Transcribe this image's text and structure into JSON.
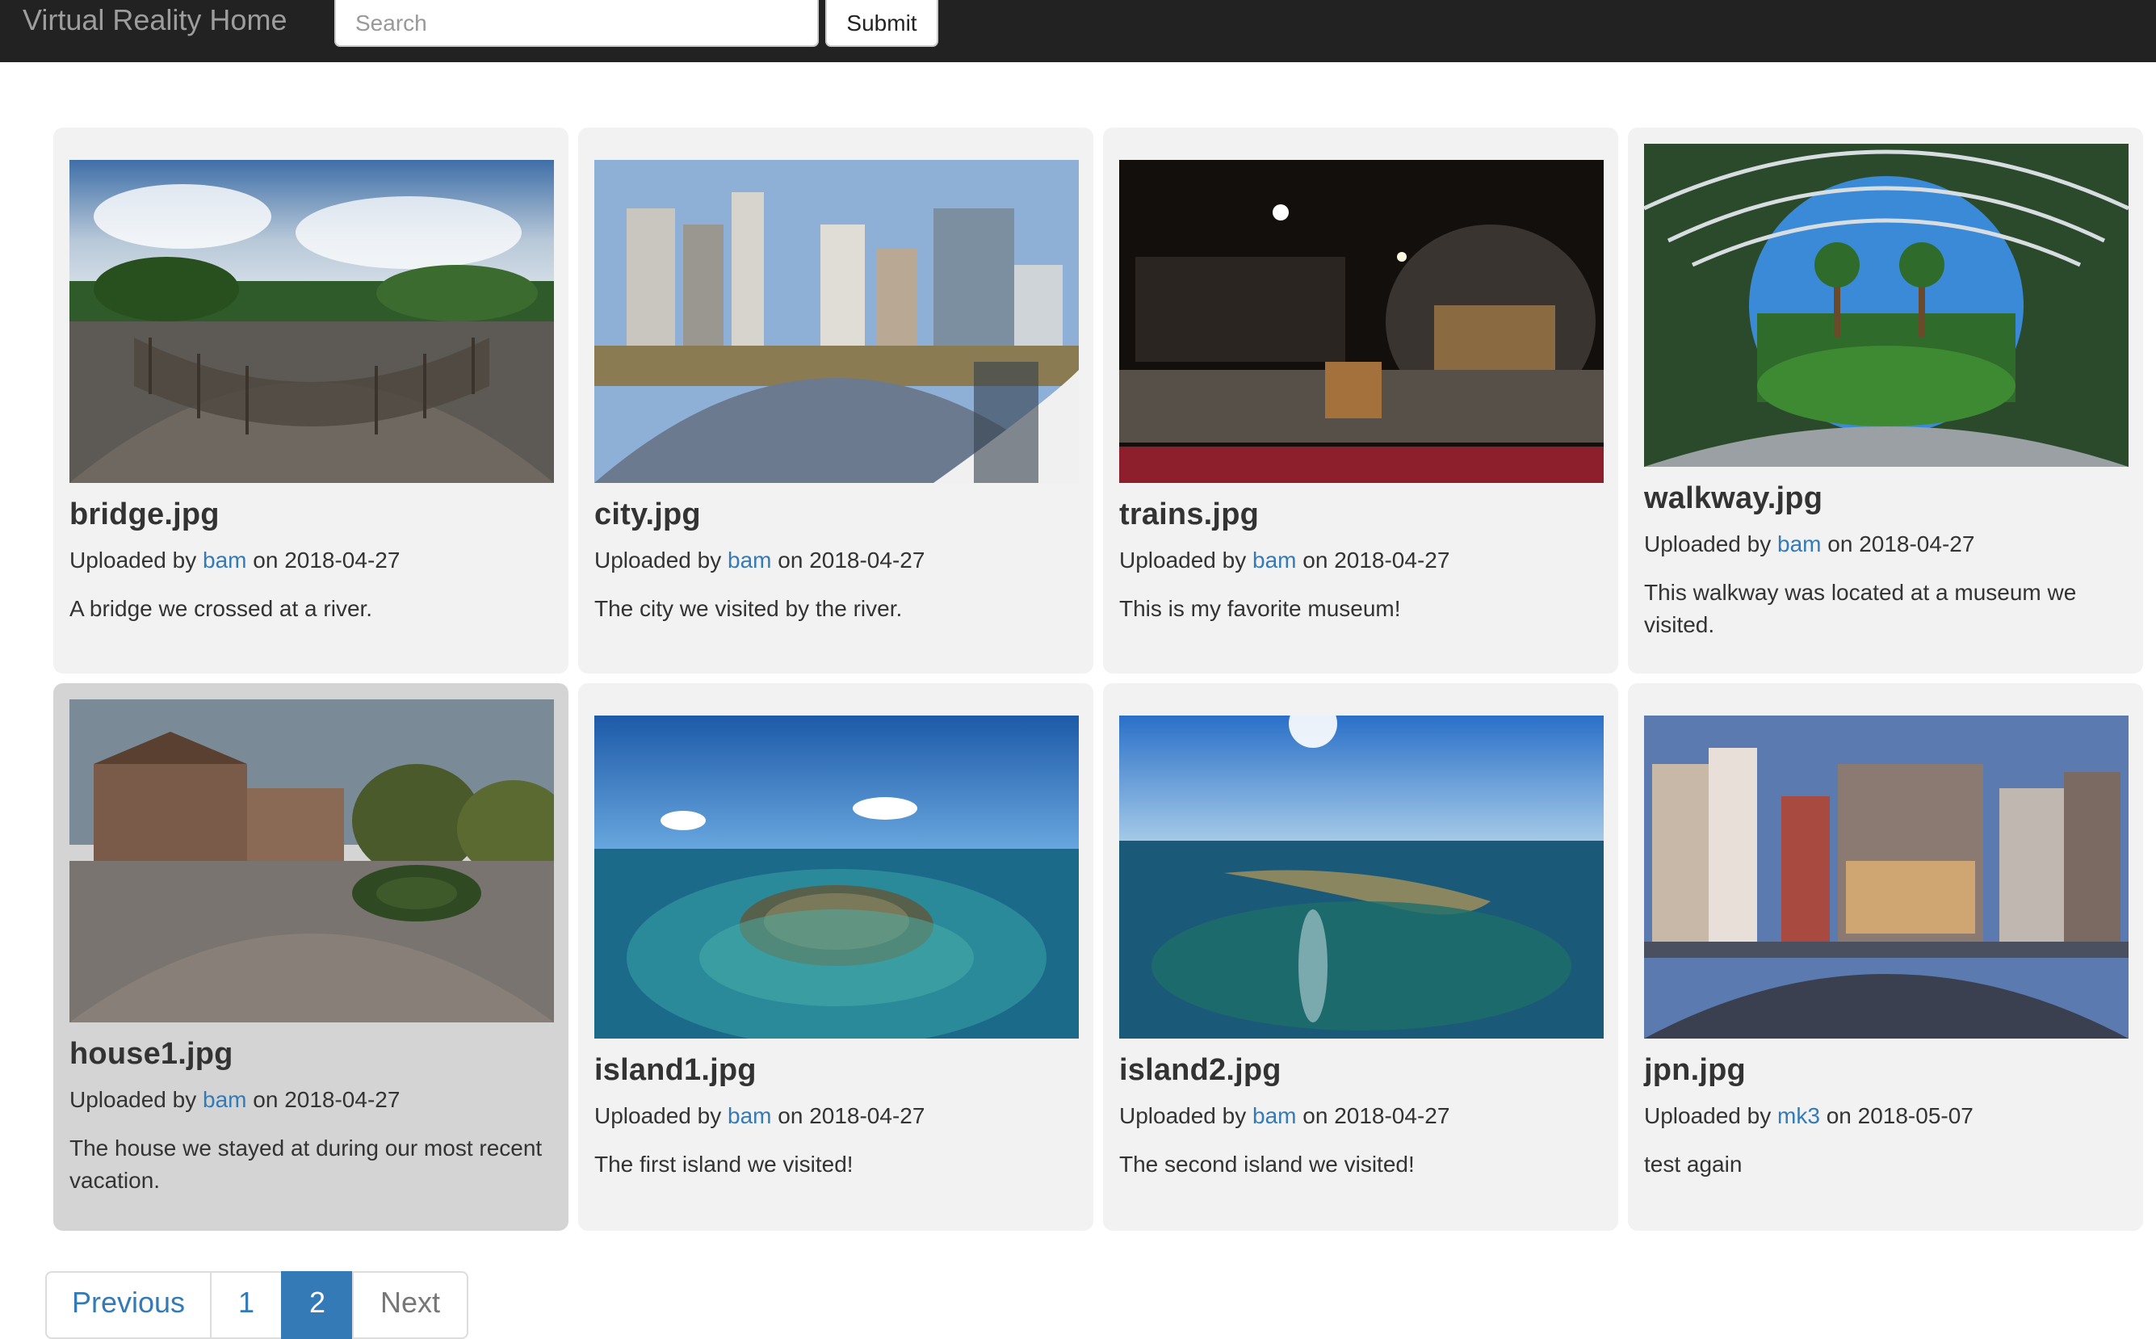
{
  "navbar": {
    "brand": "Virtual Reality Home",
    "search_placeholder": "Search",
    "submit_label": "Submit"
  },
  "cards": [
    {
      "title": "bridge.jpg",
      "uploaded_prefix": "Uploaded by",
      "user": "bam",
      "date_text": "on 2018-04-27",
      "description": "A bridge we crossed at a river."
    },
    {
      "title": "city.jpg",
      "uploaded_prefix": "Uploaded by",
      "user": "bam",
      "date_text": "on 2018-04-27",
      "description": "The city we visited by the river."
    },
    {
      "title": "trains.jpg",
      "uploaded_prefix": "Uploaded by",
      "user": "bam",
      "date_text": "on 2018-04-27",
      "description": "This is my favorite museum!"
    },
    {
      "title": "walkway.jpg",
      "uploaded_prefix": "Uploaded by",
      "user": "bam",
      "date_text": "on 2018-04-27",
      "description": "This walkway was located at a museum we visited."
    },
    {
      "title": "house1.jpg",
      "uploaded_prefix": "Uploaded by",
      "user": "bam",
      "date_text": "on 2018-04-27",
      "description": "The house we stayed at during our most recent vacation."
    },
    {
      "title": "island1.jpg",
      "uploaded_prefix": "Uploaded by",
      "user": "bam",
      "date_text": "on 2018-04-27",
      "description": "The first island we visited!"
    },
    {
      "title": "island2.jpg",
      "uploaded_prefix": "Uploaded by",
      "user": "bam",
      "date_text": "on 2018-04-27",
      "description": "The second island we visited!"
    },
    {
      "title": "jpn.jpg",
      "uploaded_prefix": "Uploaded by",
      "user": "mk3",
      "date_text": "on 2018-05-07",
      "description": "test again"
    }
  ],
  "pagination": {
    "previous_label": "Previous",
    "page_1": "1",
    "page_2": "2",
    "next_label": "Next",
    "current_page": "2"
  },
  "colors": {
    "navbar_bg": "#222222",
    "link": "#337ab7",
    "card_bg": "#f2f2f2",
    "card_hover_bg": "#d4d4d4",
    "active_page_bg": "#337ab7"
  }
}
